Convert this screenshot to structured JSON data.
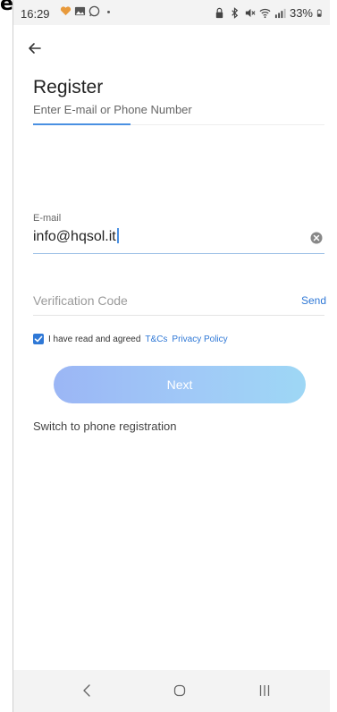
{
  "status_bar": {
    "time": "16:29",
    "battery_text": "33%",
    "left_icons": [
      "heart-icon",
      "image-icon",
      "whatsapp-icon",
      "dot-icon"
    ],
    "right_icons": [
      "lock-icon",
      "bluetooth-icon",
      "mute-icon",
      "wifi-icon",
      "signal-icon",
      "battery-icon"
    ]
  },
  "page": {
    "title": "Register",
    "tab_label": "Enter E-mail or Phone Number"
  },
  "email": {
    "label": "E-mail",
    "value": "info@hqsol.it"
  },
  "verification": {
    "placeholder": "Verification Code",
    "send_label": "Send"
  },
  "agreement": {
    "checked": true,
    "text": "I have read and agreed",
    "tc_link": "T&Cs",
    "privacy_link": "Privacy Policy"
  },
  "next_button": {
    "label": "Next"
  },
  "switch_link": {
    "label": "Switch to phone registration"
  },
  "colors": {
    "accent": "#2f78d6",
    "button_gradient_start": "#9bb6f5",
    "button_gradient_end": "#9ed7f5"
  }
}
